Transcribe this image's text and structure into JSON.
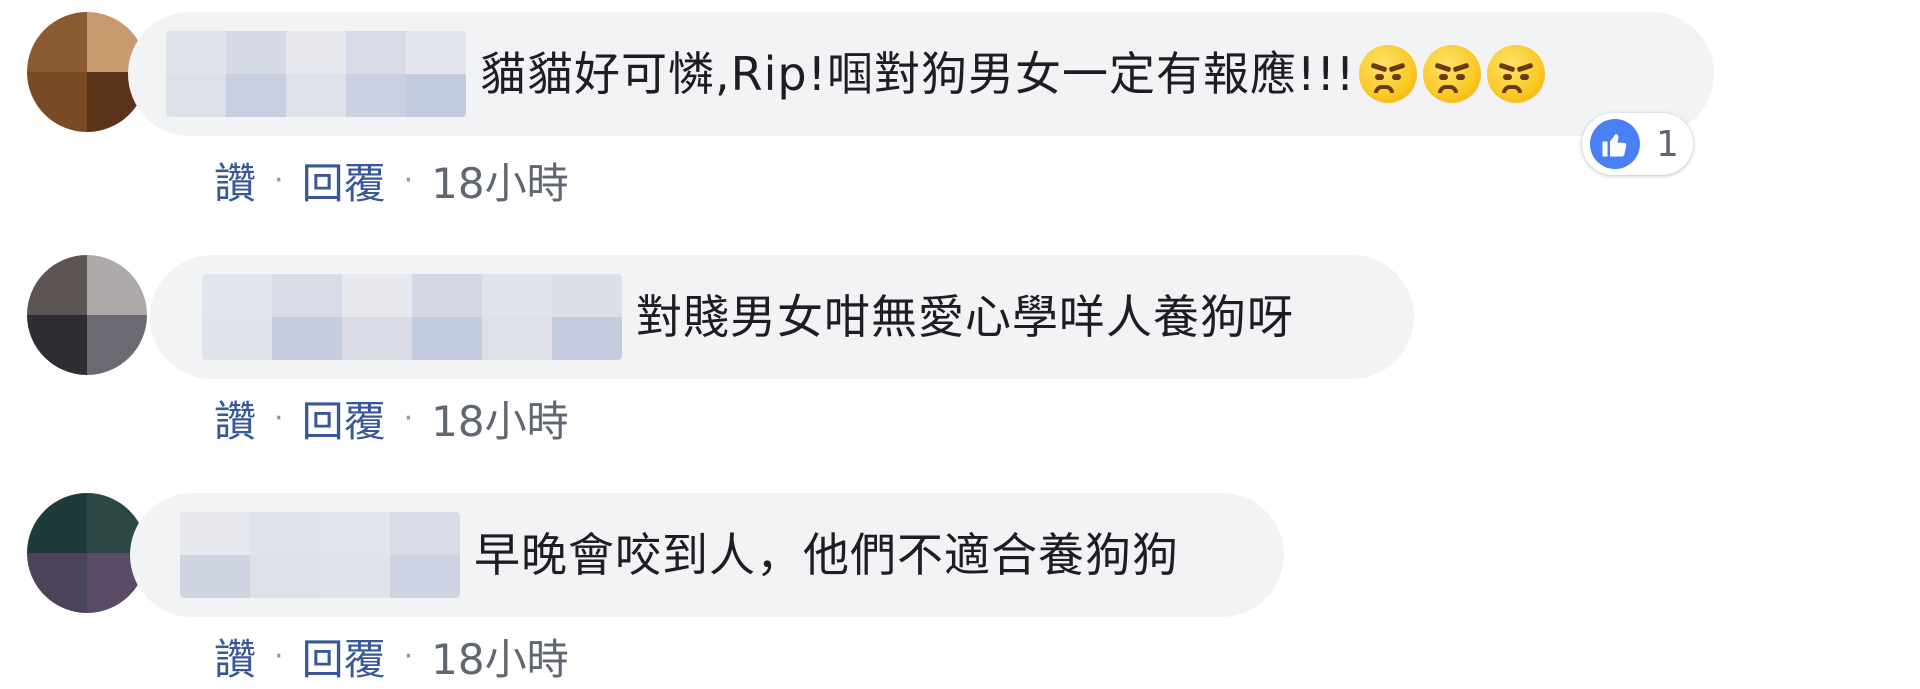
{
  "comments": [
    {
      "text": "貓貓好可憐,Rip!啯對狗男女一定有報應!!!",
      "emojis": [
        "angry-face",
        "angry-face",
        "angry-face"
      ],
      "reaction": {
        "icon": "like",
        "count": "1"
      },
      "actions": {
        "like": "讚",
        "reply": "回覆",
        "time": "18小時"
      }
    },
    {
      "text": "對賤男女咁無愛心學咩人養狗呀",
      "actions": {
        "like": "讚",
        "reply": "回覆",
        "time": "18小時"
      }
    },
    {
      "text": "早晚會咬到人，他們不適合養狗狗",
      "actions": {
        "like": "讚",
        "reply": "回覆",
        "time": "18小時"
      }
    }
  ],
  "separator": "·",
  "colors": {
    "bubble": "#f2f3f5",
    "link": "#385898",
    "like_blue": "#4a80f5"
  }
}
